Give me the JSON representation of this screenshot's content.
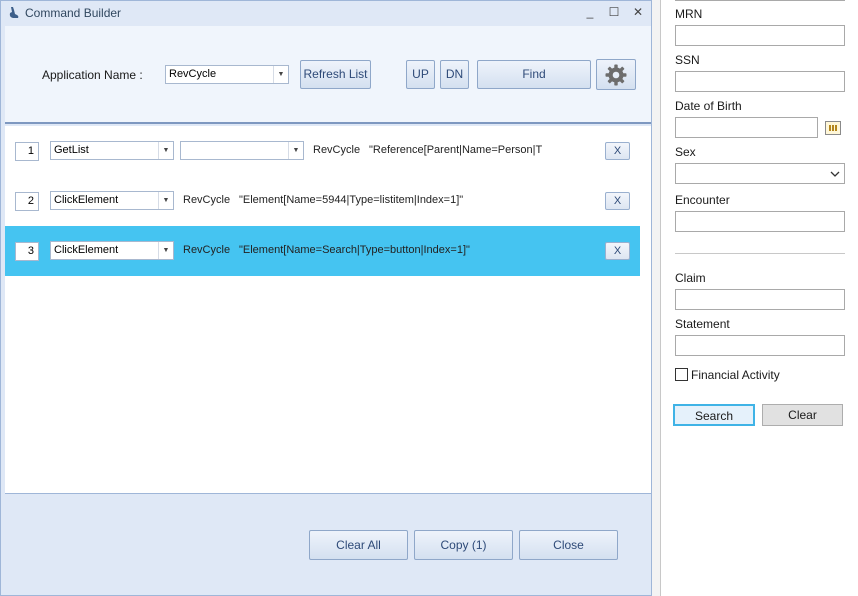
{
  "window": {
    "title": "Command Builder",
    "minimize": "_",
    "maximize": "☐",
    "close": "✕"
  },
  "toolbar": {
    "app_name_label": "Application Name :",
    "app_name_value": "RevCycle",
    "refresh_label": "Refresh List",
    "up_label": "UP",
    "dn_label": "DN",
    "find_label": "Find",
    "settings_icon": "gear-icon"
  },
  "commands": [
    {
      "index": "1",
      "action": "GetList",
      "secondary": "",
      "app": "RevCycle",
      "target": "\"Reference[Parent|Name=Person|T",
      "remove": "X"
    },
    {
      "index": "2",
      "action": "ClickElement",
      "app": "RevCycle",
      "target": "\"Element[Name=5944|Type=listitem|Index=1]\"",
      "remove": "X"
    },
    {
      "index": "3",
      "action": "ClickElement",
      "app": "RevCycle",
      "target": "\"Element[Name=Search|Type=button|Index=1]\"",
      "remove": "X"
    }
  ],
  "footer": {
    "clear_all": "Clear All",
    "copy": "Copy (1)",
    "close": "Close"
  },
  "search": {
    "mrn_label": "MRN",
    "ssn_label": "SSN",
    "dob_label": "Date of Birth",
    "sex_label": "Sex",
    "encounter_label": "Encounter",
    "claim_label": "Claim",
    "statement_label": "Statement",
    "financial_activity_label": "Financial Activity",
    "search_button": "Search",
    "clear_button": "Clear"
  },
  "colors": {
    "selected_row": "#45c4f1",
    "window_bg": "#dfe8f6",
    "search_focus": "#3fb3e6"
  }
}
